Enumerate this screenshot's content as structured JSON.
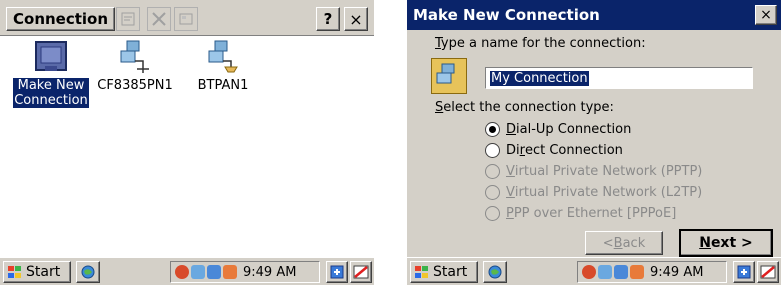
{
  "left": {
    "toolbar": {
      "title": "Connection",
      "help_label": "?",
      "close_label": "×"
    },
    "icons": [
      {
        "line1": "Make New",
        "line2": "Connection",
        "selected": true
      },
      {
        "line1": "CF8385PN1",
        "line2": "",
        "selected": false
      },
      {
        "line1": "BTPAN1",
        "line2": "",
        "selected": false
      }
    ],
    "taskbar": {
      "start_label": "Start",
      "clock": "9:49 AM"
    }
  },
  "right": {
    "dialog": {
      "title": "Make New Connection",
      "close_label": "×",
      "name_prompt_first": "T",
      "name_prompt_rest": "ype a name for the connection:",
      "name_value": "My Connection",
      "type_prompt_first": "S",
      "type_prompt_rest": "elect the connection type:",
      "options": [
        {
          "first": "D",
          "rest": "ial-Up Connection",
          "checked": true,
          "disabled": false
        },
        {
          "first": "Di",
          "rest_u": "r",
          "rest": "ect Connection",
          "checked": false,
          "disabled": false
        },
        {
          "first": "V",
          "rest": "irtual Private Network (PPTP)",
          "checked": false,
          "disabled": true
        },
        {
          "first": "V",
          "rest": "irtual Private Network (L2TP)",
          "checked": false,
          "disabled": true
        },
        {
          "first": "P",
          "rest": "PP over Ethernet [PPPoE]",
          "checked": false,
          "disabled": true
        }
      ],
      "back_label_pre": "< ",
      "back_label_u": "B",
      "back_label_post": "ack",
      "next_label_u": "N",
      "next_label_post": "ext >"
    },
    "taskbar": {
      "start_label": "Start",
      "clock": "9:49 AM"
    }
  },
  "colors": {
    "selection": "#0a246a",
    "chrome": "#d4d0c8"
  },
  "icons_semantic": [
    "properties-icon",
    "delete-icon",
    "view-icon",
    "help-icon",
    "close-icon",
    "make-new-connection-icon",
    "network-connection-icon",
    "start-flag-icon",
    "desktop-icon",
    "network-tray-icon",
    "connection-tray-icon",
    "input-panel-icon",
    "keyboard-icon"
  ]
}
